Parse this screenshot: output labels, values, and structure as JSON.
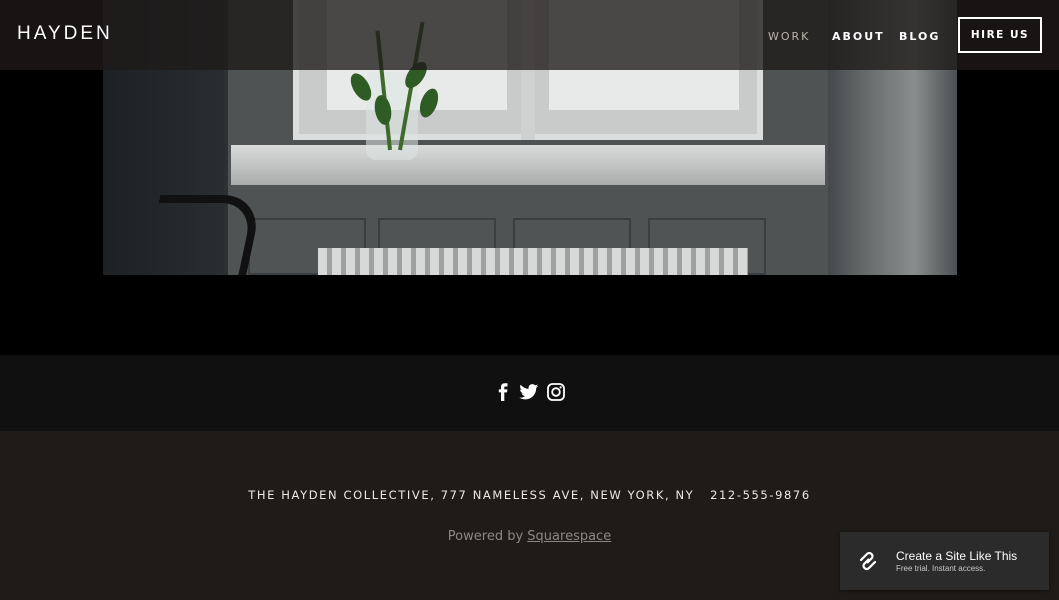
{
  "header": {
    "logo": "HAYDEN",
    "nav": [
      {
        "label": "WORK"
      },
      {
        "label": "ABOUT"
      },
      {
        "label": "BLOG"
      }
    ],
    "cta_label": "HIRE US"
  },
  "hero": {
    "image_alt": "Window with flowers in a vase above a radiator"
  },
  "social": {
    "icons": [
      "facebook-icon",
      "twitter-icon",
      "instagram-icon"
    ]
  },
  "footer": {
    "address": "THE HAYDEN COLLECTIVE, 777 NAMELESS AVE, NEW YORK, NY   212-555-9876",
    "powered_prefix": "Powered by",
    "powered_link": "Squarespace"
  },
  "badge": {
    "title": "Create a Site Like This",
    "subtitle": "Free trial. Instant access."
  },
  "colors": {
    "header_bg": "#1e1a18",
    "social_bg": "#101010",
    "footer_bg": "#1f1b18",
    "nav_active": "#b9b4ae"
  }
}
